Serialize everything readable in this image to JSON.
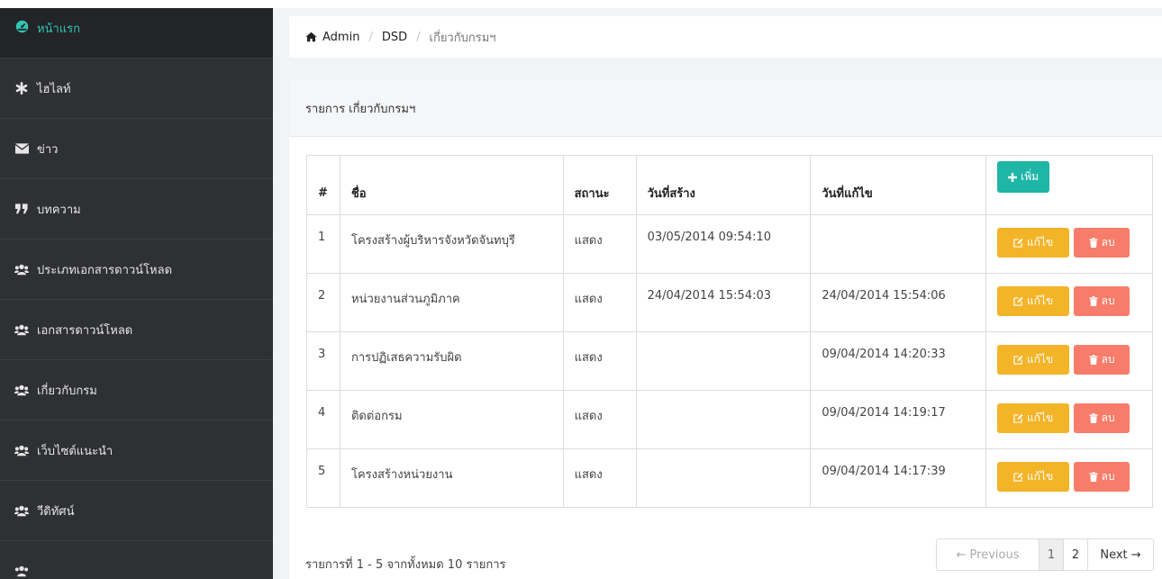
{
  "sidebar": {
    "items": [
      {
        "label": "หน้าแรก",
        "icon": "dashboard-icon"
      },
      {
        "label": "ไฮไลท์",
        "icon": "asterisk-icon"
      },
      {
        "label": "ข่าว",
        "icon": "envelope-icon"
      },
      {
        "label": "บทความ",
        "icon": "quote-icon"
      },
      {
        "label": "ประเภทเอกสารดาวน์โหลด",
        "icon": "users-icon"
      },
      {
        "label": "เอกสารดาวน์โหลด",
        "icon": "users-icon"
      },
      {
        "label": "เกี่ยวกับกรม",
        "icon": "users-icon"
      },
      {
        "label": "เว็บไซต์แนะนำ",
        "icon": "users-icon"
      },
      {
        "label": "วีดิทัศน์",
        "icon": "users-icon"
      },
      {
        "label": "",
        "icon": "users-icon"
      }
    ]
  },
  "breadcrumb": {
    "home_icon": "home-icon",
    "items": [
      "Admin",
      "DSD"
    ],
    "separator": "/",
    "active": "เกี่ยวกับกรมฯ"
  },
  "panel": {
    "title": "รายการ เกี่ยวกับกรมฯ"
  },
  "table": {
    "headers": {
      "num": "#",
      "name": "ชื่อ",
      "status": "สถานะ",
      "created": "วันที่สร้าง",
      "modified": "วันที่แก้ไข"
    },
    "add_label": "เพิ่ม",
    "edit_label": "แก้ไข",
    "delete_label": "ลบ",
    "rows": [
      {
        "num": "1",
        "name": "โครงสร้างผู้บริหารจังหวัดจันทบุรี",
        "status": "แสดง",
        "created": "03/05/2014 09:54:10",
        "modified": ""
      },
      {
        "num": "2",
        "name": "หน่วยงานส่วนภูมิภาค",
        "status": "แสดง",
        "created": "24/04/2014 15:54:03",
        "modified": "24/04/2014 15:54:06"
      },
      {
        "num": "3",
        "name": "การปฏิเสธความรับผิด",
        "status": "แสดง",
        "created": "",
        "modified": "09/04/2014 14:20:33"
      },
      {
        "num": "4",
        "name": "ติดต่อกรม",
        "status": "แสดง",
        "created": "",
        "modified": "09/04/2014 14:19:17"
      },
      {
        "num": "5",
        "name": "โครงสร้างหน่วยงาน",
        "status": "แสดง",
        "created": "",
        "modified": "09/04/2014 14:17:39"
      }
    ]
  },
  "footer": {
    "info": "รายการที่ 1 - 5 จากทั้งหมด 10 รายการ"
  },
  "pagination": {
    "previous": "← Previous",
    "pages": [
      "1",
      "2"
    ],
    "current": "1",
    "next": "Next →"
  },
  "colors": {
    "sidebar_bg": "#2f3033",
    "add_button": "#1fb5a7",
    "edit_button": "#f4b428",
    "delete_button": "#f77c6a"
  }
}
